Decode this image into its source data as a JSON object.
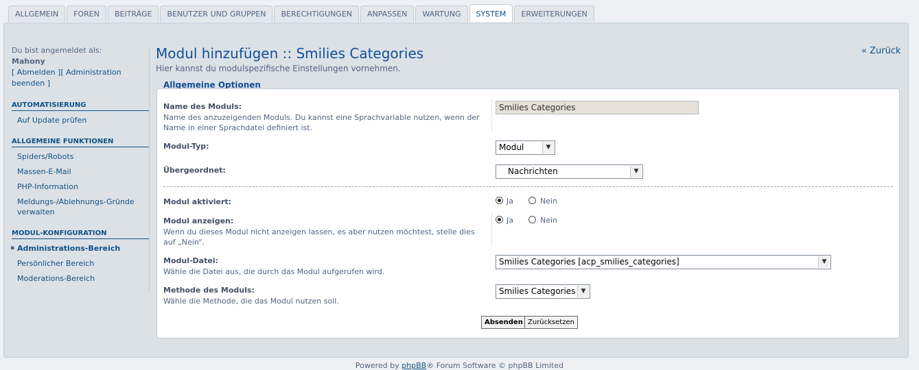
{
  "tabs": [
    "ALLGEMEIN",
    "FOREN",
    "BEITRÄGE",
    "BENUTZER UND GRUPPEN",
    "BERECHTIGUNGEN",
    "ANPASSEN",
    "WARTUNG",
    "SYSTEM",
    "ERWEITERUNGEN"
  ],
  "active_tab": "SYSTEM",
  "sidebar": {
    "logged_in_label": "Du bist angemeldet als:",
    "username": "Mahony",
    "logout_link": "[ Abmelden ]",
    "admin_end_link": "[ Administration beenden ]",
    "sections": [
      {
        "title": "AUTOMATISIERUNG",
        "items": [
          "Auf Update prüfen"
        ]
      },
      {
        "title": "ALLGEMEINE FUNKTIONEN",
        "items": [
          "Spiders/Robots",
          "Massen-E-Mail",
          "PHP-Information",
          "Meldungs-/Ablehnungs-Gründe verwalten"
        ]
      },
      {
        "title": "MODUL-KONFIGURATION",
        "items": [
          "Administrations-Bereich",
          "Persönlicher Bereich",
          "Moderations-Bereich"
        ],
        "active": "Administrations-Bereich"
      }
    ]
  },
  "main": {
    "title": "Modul hinzufügen :: Smilies Categories",
    "subtitle": "Hier kannst du modulspezifische Einstellungen vornehmen.",
    "back_link": "« Zurück",
    "legend": "Allgemeine Optionen",
    "fields": {
      "name": {
        "label": "Name des Moduls:",
        "desc": "Name des anzuzeigenden Moduls. Du kannst eine Sprachvariable nutzen, wenn der Name in einer Sprachdatei definiert ist.",
        "value": "Smilies Categories"
      },
      "type": {
        "label": "Modul-Typ:",
        "value": "Modul"
      },
      "parent": {
        "label": "Übergeordnet:",
        "value": "Nachrichten"
      },
      "enabled": {
        "label": "Modul aktiviert:",
        "yes": "Ja",
        "no": "Nein",
        "selected": "Ja"
      },
      "display": {
        "label": "Modul anzeigen:",
        "desc": "Wenn du dieses Modul nicht anzeigen lassen, es aber nutzen möchtest, stelle dies auf „Nein“.",
        "yes": "Ja",
        "no": "Nein",
        "selected": "Ja"
      },
      "file": {
        "label": "Modul-Datei:",
        "desc": "Wähle die Datei aus, die durch das Modul aufgerufen wird.",
        "value": "Smilies Categories [acp_smilies_categories]"
      },
      "mode": {
        "label": "Methode des Moduls:",
        "desc": "Wähle die Methode, die das Modul nutzen soll.",
        "value": "Smilies Categories"
      }
    },
    "buttons": {
      "submit": "Absenden",
      "reset": "Zurücksetzen"
    }
  },
  "footer": {
    "prefix": "Powered by ",
    "link": "phpBB",
    "suffix": "® Forum Software © phpBB Limited"
  }
}
